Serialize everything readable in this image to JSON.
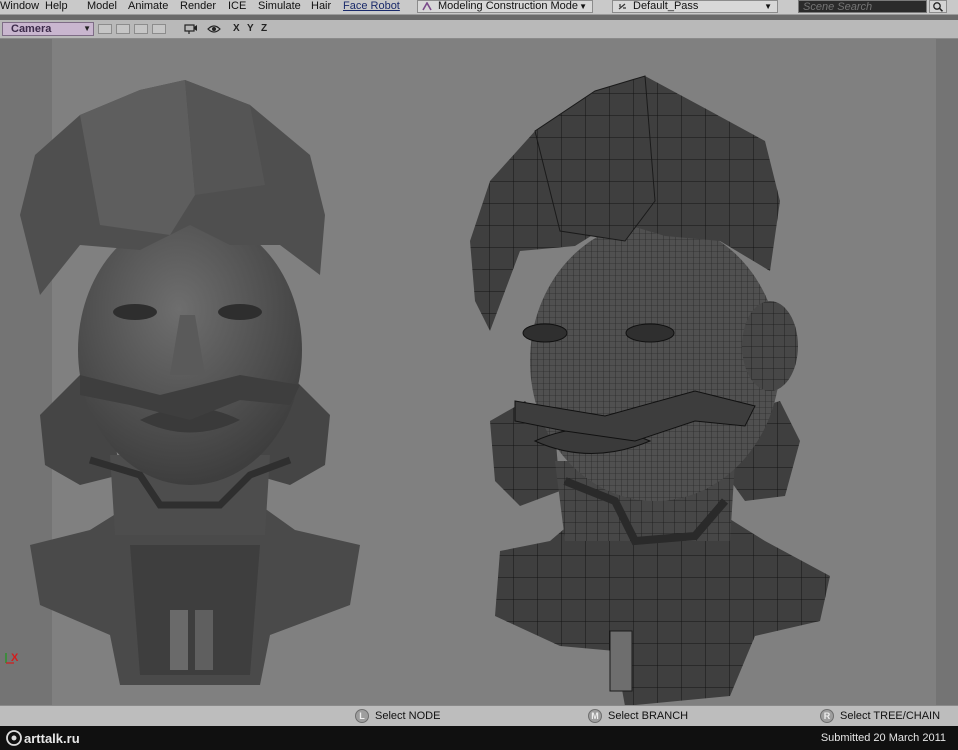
{
  "menu": {
    "items": [
      "Window",
      "Help",
      "Model",
      "Animate",
      "Render",
      "ICE",
      "Simulate",
      "Hair",
      "Face Robot"
    ],
    "mode": "Modeling Construction Mode",
    "pass": "Default_Pass",
    "search_placeholder": "Scene Search"
  },
  "viewport": {
    "camera_label": "Camera",
    "axes": [
      "X",
      "Y",
      "Z"
    ],
    "gizmo_axis": "X"
  },
  "status": {
    "left": {
      "key": "L",
      "text": "Select NODE"
    },
    "middle": {
      "key": "M",
      "text": "Select BRANCH"
    },
    "right": {
      "key": "R",
      "text": "Select TREE/CHAIN"
    }
  },
  "footer": {
    "logo_text": "arttalk.ru",
    "submitted": "Submitted 20 March 2011"
  },
  "colors": {
    "axis_x": "#d41c1c",
    "camera_bg": "#c9b6cf",
    "viewport_bg": "#808080"
  }
}
